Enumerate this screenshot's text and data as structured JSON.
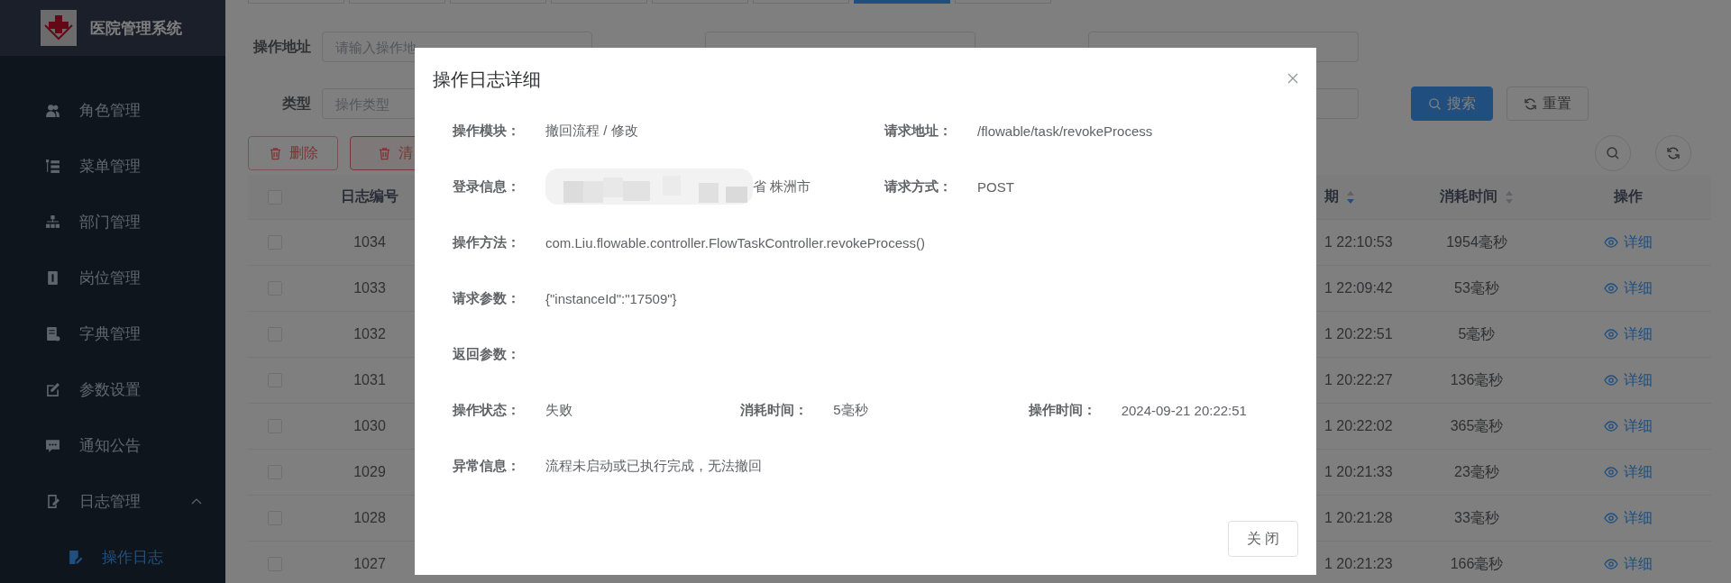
{
  "sidebar": {
    "title": "医院管理系统",
    "items": [
      {
        "label": "角色管理"
      },
      {
        "label": "菜单管理"
      },
      {
        "label": "部门管理"
      },
      {
        "label": "岗位管理"
      },
      {
        "label": "字典管理"
      },
      {
        "label": "参数设置"
      },
      {
        "label": "通知公告"
      },
      {
        "label": "日志管理",
        "expanded": true,
        "children": [
          {
            "label": "操作日志",
            "selected": true
          }
        ]
      }
    ]
  },
  "tabs": [
    {
      "selected": false
    },
    {
      "selected": false
    },
    {
      "selected": false
    },
    {
      "selected": false
    },
    {
      "selected": false
    },
    {
      "selected": false
    },
    {
      "selected": true
    },
    {
      "selected": false
    }
  ],
  "search": {
    "row1": [
      {
        "label": "操作地址",
        "placeholder": "请输入操作地"
      }
    ],
    "type_label": "类型",
    "type_placeholder": "操作类型",
    "search_button": "搜索",
    "reset_button": "重置"
  },
  "toolbar": [
    {
      "label": "删除",
      "disabled": true
    },
    {
      "label": "清",
      "disabled": false
    }
  ],
  "table": {
    "header_checked": false,
    "columns": [
      {
        "label": "日志编号"
      },
      {
        "label": "期",
        "sorted": true
      },
      {
        "label": "消耗时间",
        "sorted": false
      },
      {
        "label": "操作"
      }
    ],
    "rows": [
      {
        "checked": false,
        "id": "1034",
        "time": "1 22:10:53",
        "cost": "1954毫秒",
        "action": "详细"
      },
      {
        "checked": false,
        "id": "1033",
        "time": "1 22:09:42",
        "cost": "53毫秒",
        "action": "详细"
      },
      {
        "checked": false,
        "id": "1032",
        "time": "1 20:22:51",
        "cost": "5毫秒",
        "action": "详细"
      },
      {
        "checked": false,
        "id": "1031",
        "time": "1 20:22:27",
        "cost": "136毫秒",
        "action": "详细"
      },
      {
        "checked": false,
        "id": "1030",
        "time": "1 20:22:02",
        "cost": "365毫秒",
        "action": "详细"
      },
      {
        "checked": false,
        "id": "1029",
        "time": "1 20:21:33",
        "cost": "23毫秒",
        "action": "详细"
      },
      {
        "checked": false,
        "id": "1028",
        "time": "1 20:21:28",
        "cost": "33毫秒",
        "action": "详细"
      },
      {
        "checked": false,
        "id": "1027",
        "time": "1 20:21:23",
        "cost": "166毫秒",
        "action": "详细"
      }
    ]
  },
  "dialog": {
    "title": "操作日志详细",
    "close_button": "关 闭",
    "rows": [
      [
        {
          "label": "操作模块：",
          "value": "撤回流程 / 修改"
        },
        {
          "label": "请求地址：",
          "value": "/flowable/task/revokeProcess"
        }
      ],
      [
        {
          "label": "登录信息：",
          "value": "省 株洲市",
          "redacted": true
        },
        {
          "label": "请求方式：",
          "value": "POST"
        }
      ],
      [
        {
          "label": "操作方法：",
          "value": "com.Liu.flowable.controller.FlowTaskController.revokeProcess()"
        }
      ],
      [
        {
          "label": "请求参数：",
          "value": "{\"instanceId\":\"17509\"}"
        }
      ],
      [
        {
          "label": "返回参数："
        }
      ],
      [
        {
          "label": "操作状态：",
          "value": "失败"
        },
        {
          "label": "消耗时间：",
          "value": "5毫秒"
        },
        {
          "label": "操作时间：",
          "value": "2024-09-21 20:22:51"
        }
      ],
      [
        {
          "label": "异常信息：",
          "value": "流程未启动或已执行完成，无法撤回"
        }
      ]
    ]
  }
}
